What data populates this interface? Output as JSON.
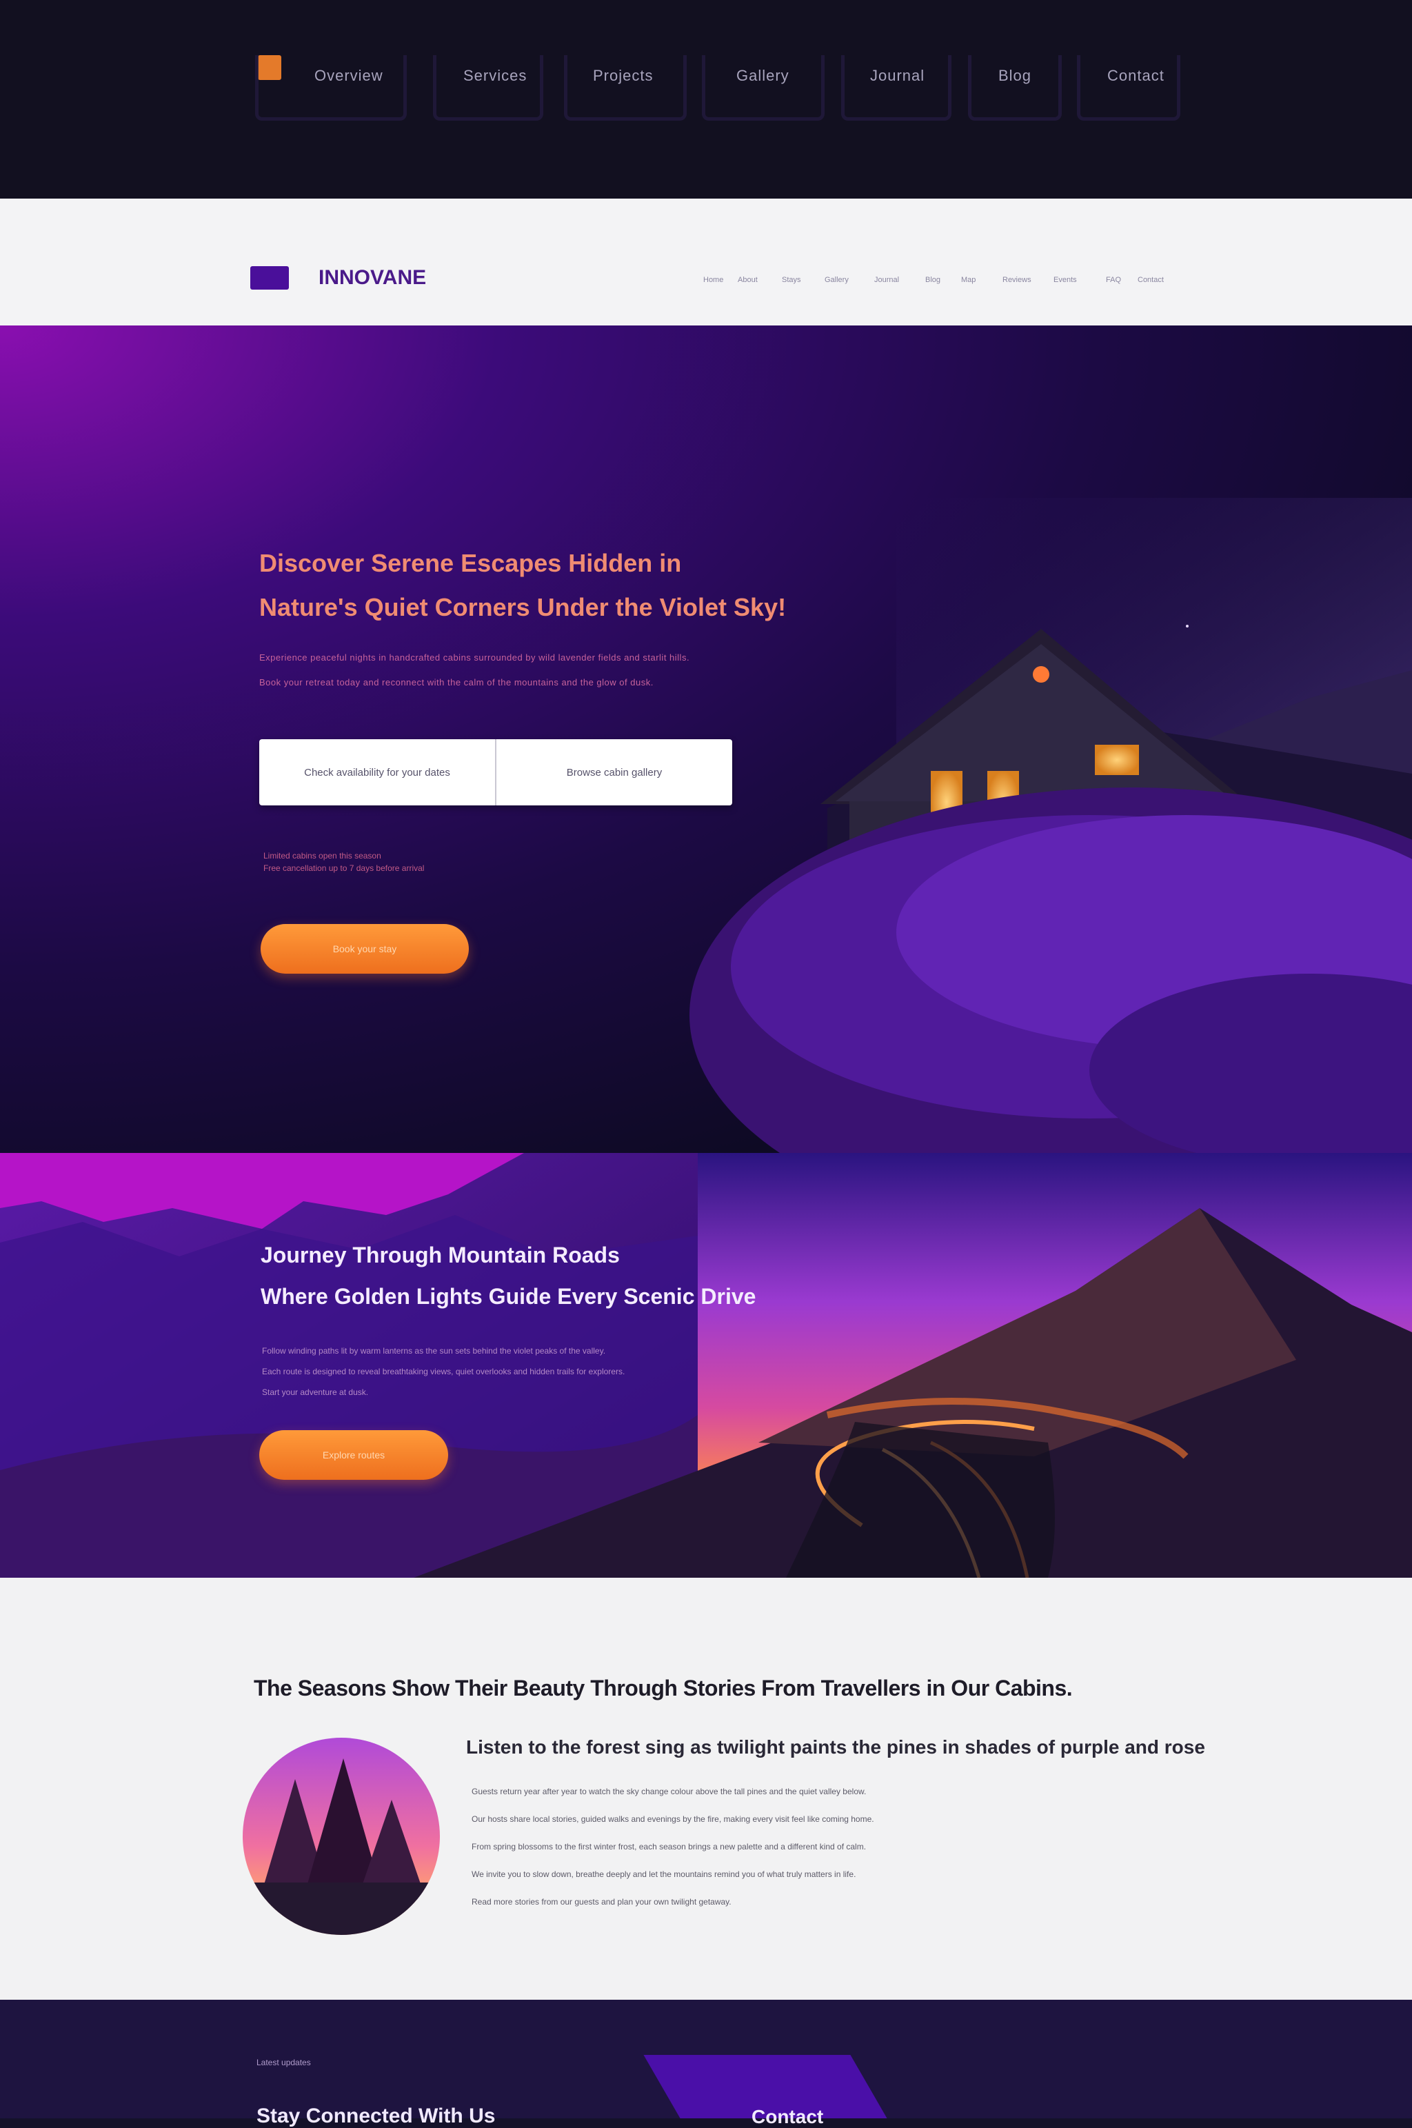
{
  "topnav": {
    "links": [
      "Overview",
      "Services",
      "Projects",
      "Gallery",
      "Journal",
      "Blog",
      "Contact"
    ]
  },
  "header": {
    "brand": "INNOVANE",
    "nav": [
      "Home",
      "About",
      "Stays",
      "Gallery",
      "Journal",
      "Blog",
      "Map",
      "Reviews",
      "Events",
      "FAQ",
      "Contact"
    ]
  },
  "hero": {
    "title_line1": "Discover Serene Escapes Hidden in",
    "title_line2": "Nature's Quiet Corners Under the Violet Sky!",
    "subtitle_line1": "Experience peaceful nights in handcrafted cabins surrounded by wild lavender fields and starlit hills.",
    "subtitle_line2": "Book your retreat today and reconnect with the calm of the mountains and the glow of dusk.",
    "option_left": "Check availability for your dates",
    "option_right": "Browse cabin gallery",
    "small_note_line1": "Limited cabins open this season",
    "small_note_line2": "Free cancellation up to 7 days before arrival",
    "cta_label": "Book your stay"
  },
  "section2": {
    "title_line1": "Journey Through Mountain Roads",
    "title_line2": "Where Golden Lights Guide Every Scenic Drive",
    "text_line1": "Follow winding paths lit by warm lanterns as the sun sets behind the violet peaks of the valley.",
    "text_line2": "Each route is designed to reveal breathtaking views, quiet overlooks and hidden trails for explorers.",
    "text_line3": "Start your adventure at dusk.",
    "cta_label": "Explore routes"
  },
  "section3": {
    "heading": "The Seasons Show Their Beauty Through Stories From Travellers in Our Cabins.",
    "subheading": "Listen to the forest sing as twilight paints the pines in shades of purple and rose",
    "paragraph": [
      "Guests return year after year to watch the sky change colour above the tall pines and the quiet valley below.",
      "Our hosts share local stories, guided walks and evenings by the fire, making every visit feel like coming home.",
      "From spring blossoms to the first winter frost, each season brings a new palette and a different kind of calm.",
      "We invite you to slow down, breathe deeply and let the mountains remind you of what truly matters in life.",
      "Read more stories from our guests and plan your own twilight getaway."
    ]
  },
  "footer": {
    "label": "Latest updates",
    "heading": "Stay Connected With Us",
    "heading_right": "Contact"
  },
  "colors": {
    "accent": "#f07a2a",
    "brand": "#4a0f9a",
    "hero_dark": "#0e0a24",
    "hero_purple": "#8a0fb0"
  }
}
